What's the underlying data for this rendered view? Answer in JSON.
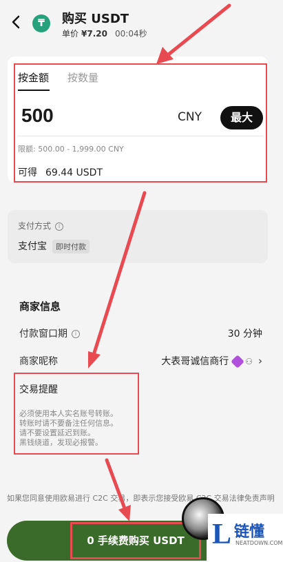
{
  "header": {
    "title": "购买 USDT",
    "coin_symbol": "₸",
    "price_label": "单价",
    "price_value": "¥7.20",
    "timer": "00:04秒"
  },
  "amount_card": {
    "tab_amount": "按金额",
    "tab_quantity": "按数量",
    "amount": "500",
    "currency": "CNY",
    "max_button": "最大",
    "limit": "限额: 500.00 - 1,999.00 CNY",
    "receive_label": "可得",
    "receive_value": "69.44 USDT"
  },
  "payment": {
    "title": "支付方式",
    "method": "支付宝",
    "tag": "即时付款"
  },
  "merchant": {
    "title": "商家信息",
    "window_label": "付款窗口期",
    "window_value": "30 分钟",
    "nickname_label": "商家昵称",
    "nickname_value": "大表哥诚信商行",
    "reminder_title": "交易提醒",
    "reminder_lines": [
      "必须使用本人实名账号转账。",
      "转账时请不要备注任何信息。",
      "请不要设置延迟到账。",
      "黑钱绕道，发现必报警。"
    ]
  },
  "footer": {
    "disclaimer": "如果您同意使用欧易进行 C2C 交易，即表示您接受欧易 C2C 交易法律免责声明",
    "buy_button": "0 手续费购买 USDT"
  },
  "watermark": {
    "logo_letter": "L",
    "logo_text": "链懂",
    "logo_sub": "NEATDOWN.COM"
  },
  "colors": {
    "annotation_red": "#e84a52",
    "button_green": "#3b6b2a",
    "accent_black": "#111111",
    "usdt_green": "#26a17b",
    "badge_purple": "#b04fdb",
    "logo_blue": "#1c55b8"
  }
}
